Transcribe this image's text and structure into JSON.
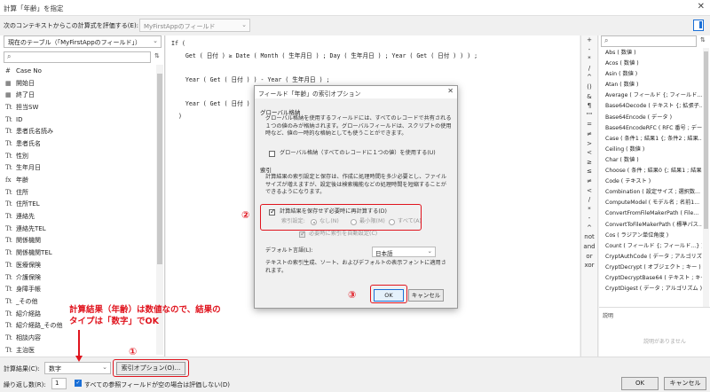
{
  "window": {
    "title": "計算「年齢」を指定",
    "close_glyph": "✕"
  },
  "context": {
    "label": "次のコンテキストからこの計算式を評価する(E):",
    "value": "MyFirstAppのフィールド"
  },
  "left": {
    "table_select": "現在のテーブル（「MyFirstAppのフィールド」）",
    "fields": [
      {
        "icon": "#",
        "name": "Case No"
      },
      {
        "icon": "▦",
        "name": "開始日"
      },
      {
        "icon": "▦",
        "name": "終了日"
      },
      {
        "icon": "Tt",
        "name": "担当SW"
      },
      {
        "icon": "Tt",
        "name": "ID"
      },
      {
        "icon": "Tt",
        "name": "患者氏名読み"
      },
      {
        "icon": "Tt",
        "name": "患者氏名"
      },
      {
        "icon": "Tt",
        "name": "性別"
      },
      {
        "icon": "Tt",
        "name": "生年月日"
      },
      {
        "icon": "fx",
        "name": "年齢"
      },
      {
        "icon": "Tt",
        "name": "住所"
      },
      {
        "icon": "Tt",
        "name": "住所TEL"
      },
      {
        "icon": "Tt",
        "name": "連絡先"
      },
      {
        "icon": "Tt",
        "name": "連絡先TEL"
      },
      {
        "icon": "Tt",
        "name": "関係機関"
      },
      {
        "icon": "Tt",
        "name": "関係機関TEL"
      },
      {
        "icon": "Tt",
        "name": "医療保険"
      },
      {
        "icon": "Tt",
        "name": "介護保険"
      },
      {
        "icon": "Tt",
        "name": "身障手帳"
      },
      {
        "icon": "Tt",
        "name": "_その他"
      },
      {
        "icon": "Tt",
        "name": "紹介経路"
      },
      {
        "icon": "Tt",
        "name": "紹介経路_その他"
      },
      {
        "icon": "Tt",
        "name": "相談内容"
      },
      {
        "icon": "Tt",
        "name": "主治医"
      }
    ]
  },
  "editor": {
    "lines": [
      "If (",
      "    Get ( 日付 ) ≥ Date ( Month ( 生年月日 ) ; Day ( 生年月日 ) ; Year ( Get ( 日付 ) ) ) ;",
      "",
      "    Year ( Get ( 日付 ) ) - Year ( 生年月日 ) ;",
      "",
      "    Year ( Get ( 日付 ) ) - Year ( 生年月日 ) - 1",
      "  )"
    ]
  },
  "operators": [
    "+",
    "-",
    "*",
    "/",
    "^",
    "()",
    "&",
    "¶",
    "\"\"",
    "=",
    "≠",
    ">",
    "<",
    "≥",
    "≤",
    "and",
    "or",
    "xor",
    "not",
    "and",
    "or",
    "xor"
  ],
  "operators_visible": [
    "+",
    "-",
    "*",
    "/",
    "^",
    "()",
    "&",
    "¶",
    "\"\"",
    "=",
    "≠",
    ">",
    "<",
    "≥",
    "≤",
    "≠",
    "<",
    "/",
    "*",
    "-",
    "^",
    "not",
    "and",
    "or",
    "xor"
  ],
  "functions": [
    "Abs ( 数値 )",
    "Acos ( 数値 )",
    "Asin ( 数値 )",
    "Atan ( 数値 )",
    "Average ( フィールド {; フィールド...} )",
    "Base64Decode ( テキスト {; 拡張子...",
    "Base64Encode ( データ )",
    "Base64EncodeRFC ( RFC 番号 ; データ...",
    "Case ( 条件1 ; 結果1 {; 条件2 ; 結果...",
    "Ceiling ( 数値 )",
    "Char ( 数値 )",
    "Choose ( 条件 ; 結果0 {; 結果1 ; 結果...",
    "Code ( テキスト )",
    "Combination ( 設定サイズ ; 選択数...",
    "ComputeModel ( モデル名 ; 名前1...",
    "ConvertFromFileMakerPath ( File...",
    "ConvertToFileMakerPath ( 標準パス...",
    "Cos ( ラジアン単位角度 )",
    "Count ( フィールド {; フィールド...} )",
    "CryptAuthCode ( データ ; アルゴリズ...",
    "CryptDecrypt ( オブジェクト ; キー )",
    "CryptDecryptBase64 ( テキスト ; キー )",
    "CryptDigest ( データ ; アルゴリズム )"
  ],
  "description": {
    "label": "説明",
    "placeholder": "説明がありません"
  },
  "bottom": {
    "result_label": "計算結果(C):",
    "result_value": "数字",
    "index_button": "索引オプション(O)...",
    "repeat_label": "繰り返し数(R):",
    "repeat_value": "1",
    "checkbox_label": "すべての参照フィールドが空の場合は評価しない(D)",
    "ok": "OK",
    "cancel": "キャンセル"
  },
  "dialog": {
    "title": "フィールド「年齢」の索引オプション",
    "close_glyph": "✕",
    "global_heading": "グローバル格納",
    "global_desc": "グローバル格納を使用するフィールドには、すべてのレコードで共有される１つの値のみが格納されます。グローバルフィールドは、スクリプトの使用時など、値の一時的な格納としても使うことができます。",
    "global_checkbox": "グローバル格納（すべてのレコードに１つの値）を使用する(U)",
    "index_heading": "索引",
    "index_desc": "計算結果の索引設定と保存は、作成に処理時間を多少必要とし、ファイルサイズが増えますが、設定後は検索機能などの処理時間を短縮することができるようになります。",
    "no_store_checkbox": "計算結果を保存せず必要時に再計算する(D)",
    "index_setting_label": "索引設定:",
    "radio_none": "なし(N)",
    "radio_min": "最小限(M)",
    "radio_all": "すべて(A)",
    "auto_index": "必要時に索引を自動設定(C)",
    "default_lang_label": "デフォルト言語(L):",
    "default_lang_value": "日本語",
    "lang_desc": "テキストの索引生成、ソート、およびデフォルトの表示フォントに適用されます。",
    "ok": "OK",
    "cancel": "キャンセル"
  },
  "annotations": {
    "note": "計算結果（年齢）は数値なので、結果の\nタイプは「数字」でOK",
    "mark1": "①",
    "mark2": "②",
    "mark3": "③"
  },
  "colors": {
    "accent": "#1a6fd6",
    "annotation_red": "#e0141e"
  }
}
